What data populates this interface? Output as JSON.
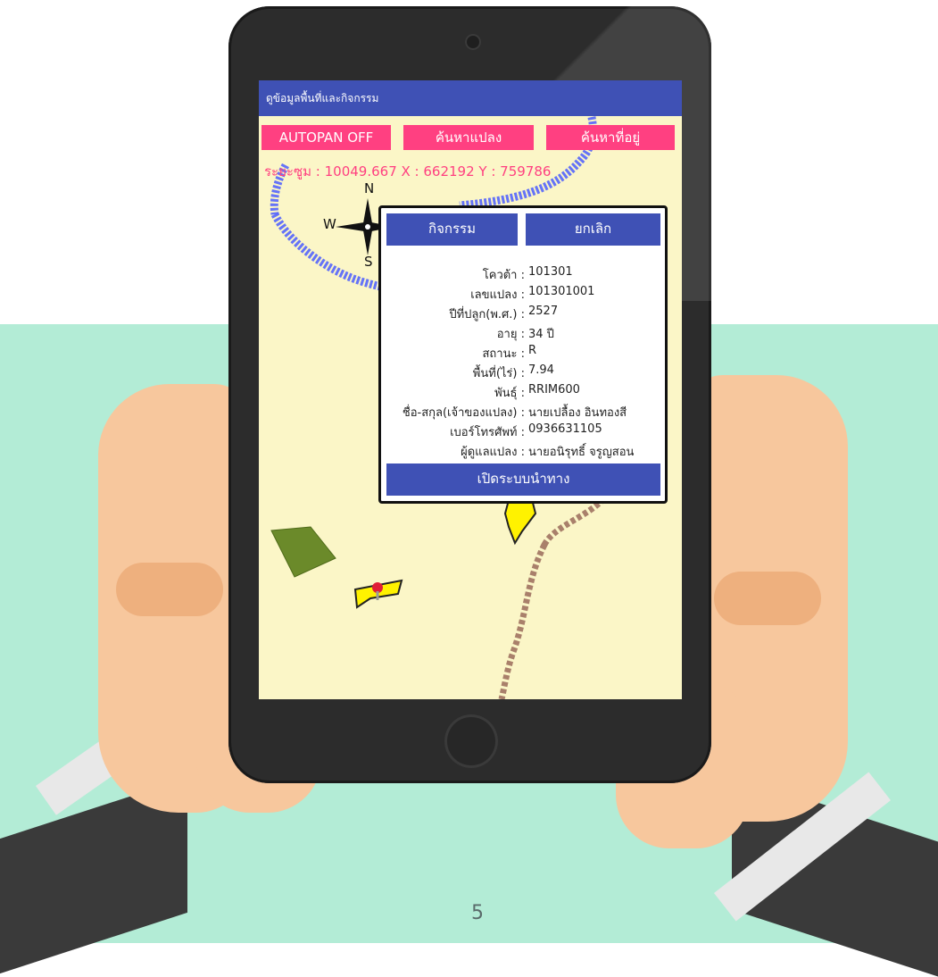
{
  "app": {
    "title": "ดูข้อมูลพื้นที่และกิจกรรม"
  },
  "toolbar": {
    "autopan_label": "AUTOPAN OFF",
    "search_plot_label": "ค้นหาแปลง",
    "search_address_label": "ค้นหาที่อยู่"
  },
  "status": {
    "coords_text": "ระยะซูม : 10049.667   X : 662192   Y : 759786"
  },
  "compass": {
    "north": "N",
    "west": "W",
    "south": "S"
  },
  "popup": {
    "activity_label": "กิจกรรม",
    "cancel_label": "ยกเลิก",
    "navigate_label": "เปิดระบบนำทาง",
    "rows": [
      {
        "label": "โควต้า :",
        "value": "101301"
      },
      {
        "label": "เลขแปลง :",
        "value": "101301001"
      },
      {
        "label": "ปีที่ปลูก(พ.ศ.) :",
        "value": "2527"
      },
      {
        "label": "อายุ :",
        "value": "34 ปี"
      },
      {
        "label": "สถานะ :",
        "value": "R"
      },
      {
        "label": "พื้นที่(ไร่) :",
        "value": "7.94"
      },
      {
        "label": "พันธุ์ :",
        "value": "RRIM600"
      },
      {
        "label": "ชื่อ-สกุล(เจ้าของแปลง) :",
        "value": "นายเปลื้อง  อินทองสี"
      },
      {
        "label": "เบอร์โทรศัพท์ :",
        "value": "0936631105"
      },
      {
        "label": "ผู้ดูแลแปลง :",
        "value": "นายอนิรุทธิ์ จรูญสอน"
      }
    ]
  },
  "colors": {
    "appbar": "#3f51b5",
    "accent": "#ff4081",
    "map_bg": "#fbf6c7",
    "background": "#b3ecd6"
  },
  "page_number": "5"
}
